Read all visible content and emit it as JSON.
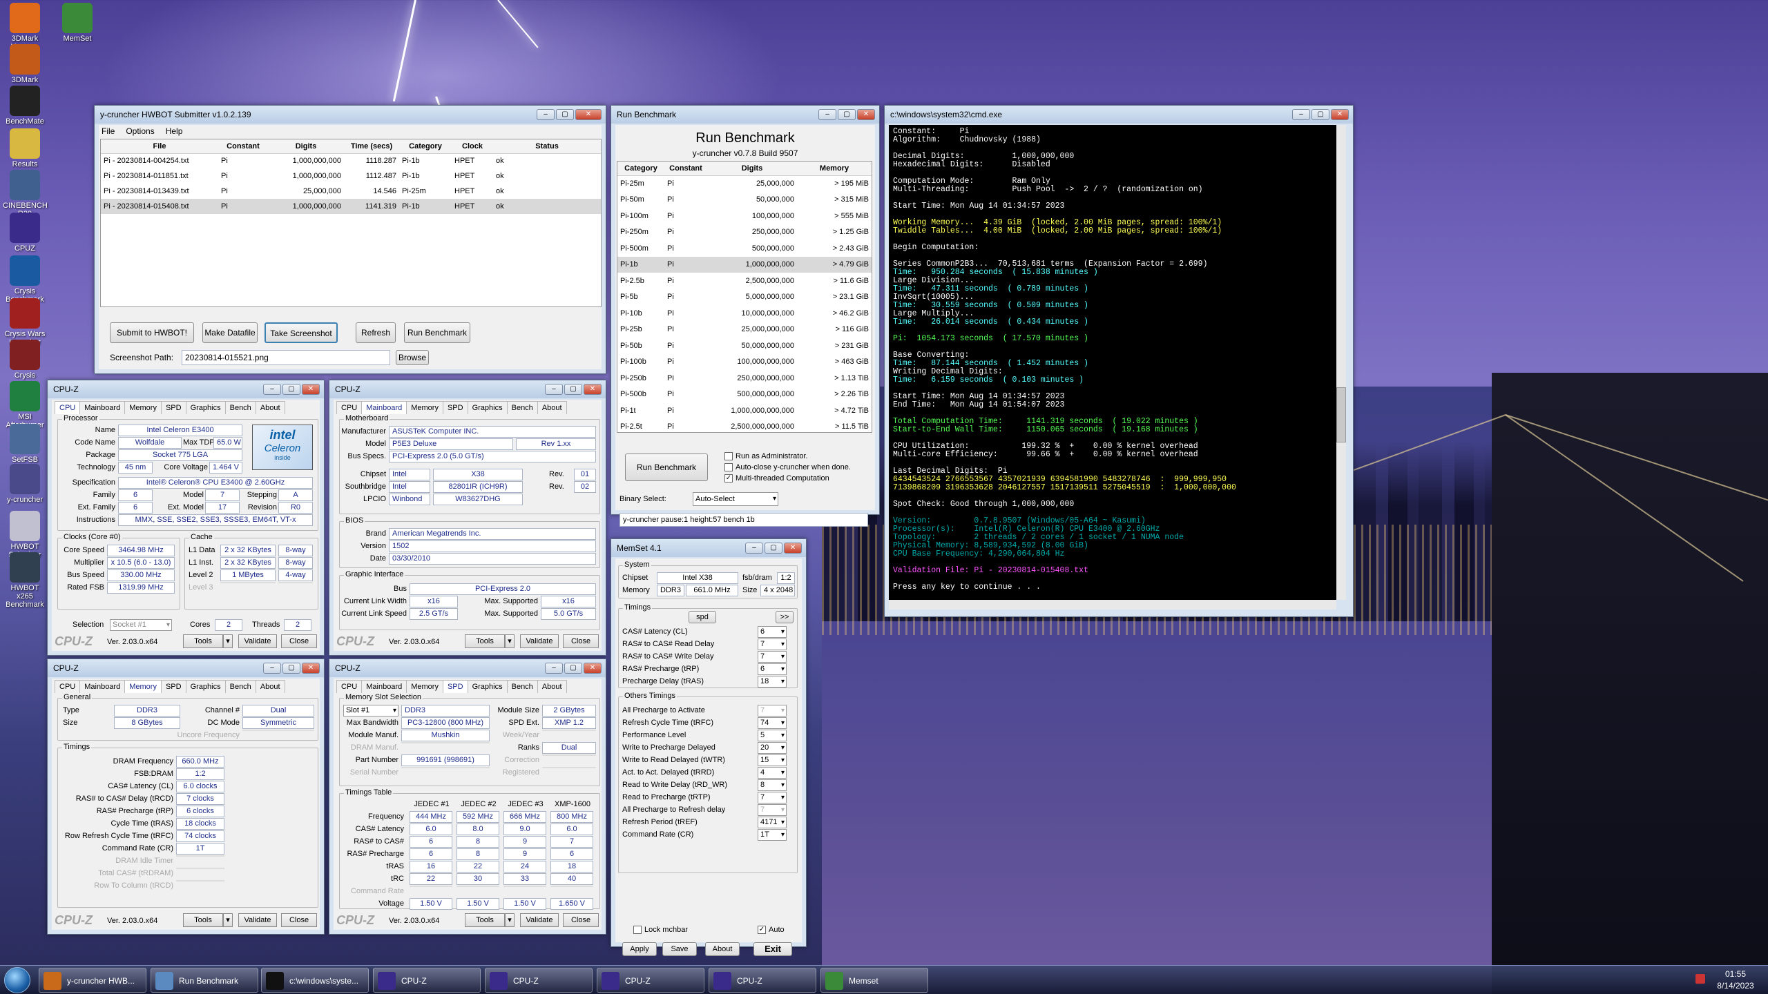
{
  "colors": {
    "accent": "#1e2d8c",
    "console_bg": "#000000"
  },
  "desktop": {
    "icons": [
      {
        "label": "3DMark Vantage",
        "icon": "3dmark-vantage-icon"
      },
      {
        "label": "MemSet",
        "icon": "memset-icon"
      },
      {
        "label": "3DMark",
        "icon": "3dmark-icon"
      },
      {
        "label": "BenchMate",
        "icon": "benchmate-icon"
      },
      {
        "label": "Results",
        "icon": "folder-icon"
      },
      {
        "label": "CINEBENCH R20",
        "icon": "cinebench-icon"
      },
      {
        "label": "CPUZ",
        "icon": "cpuz-icon"
      },
      {
        "label": "Crysis Benchmark",
        "icon": "crysis-icon"
      },
      {
        "label": "Crysis Wars Launcher",
        "icon": "crysis-wars-icon"
      },
      {
        "label": "Crysis",
        "icon": "crysis-icon"
      },
      {
        "label": "MSI Afterburner",
        "icon": "afterburner-icon"
      },
      {
        "label": "SetFSB",
        "icon": "setfsb-icon"
      },
      {
        "label": "y-cruncher",
        "icon": "ycruncher-icon"
      },
      {
        "label": "HWBOT Submitter",
        "icon": "hwbot-icon"
      },
      {
        "label": "HWBOT x265 Benchmark",
        "icon": "hwbot-x265-icon"
      }
    ]
  },
  "submitter": {
    "title": "y-cruncher HWBOT Submitter v1.0.2.139",
    "menu": [
      "File",
      "Options",
      "Help"
    ],
    "columns": [
      "File",
      "Constant",
      "Digits",
      "Time (secs)",
      "Category",
      "Clock",
      "Status"
    ],
    "rows": [
      [
        "Pi - 20230814-004254.txt",
        "Pi",
        "1,000,000,000",
        "1118.287",
        "Pi-1b",
        "HPET",
        "ok"
      ],
      [
        "Pi - 20230814-011851.txt",
        "Pi",
        "1,000,000,000",
        "1112.487",
        "Pi-1b",
        "HPET",
        "ok"
      ],
      [
        "Pi - 20230814-013439.txt",
        "Pi",
        "25,000,000",
        "14.546",
        "Pi-25m",
        "HPET",
        "ok"
      ],
      [
        "Pi - 20230814-015408.txt",
        "Pi",
        "1,000,000,000",
        "1141.319",
        "Pi-1b",
        "HPET",
        "ok"
      ]
    ],
    "buttons": [
      "Submit to HWBOT!",
      "Make Datafile",
      "Take Screenshot",
      "Refresh",
      "Run Benchmark"
    ],
    "screenshot_label": "Screenshot Path:",
    "screenshot_path": "20230814-015521.png",
    "browse": "Browse"
  },
  "runbench": {
    "title": "Run Benchmark",
    "heading": "Run Benchmark",
    "subheading": "y-cruncher v0.7.8 Build 9507",
    "columns": [
      "Category",
      "Constant",
      "Digits",
      "Memory"
    ],
    "rows": [
      [
        "Pi-25m",
        "Pi",
        "25,000,000",
        "> 195 MiB"
      ],
      [
        "Pi-50m",
        "Pi",
        "50,000,000",
        "> 315 MiB"
      ],
      [
        "Pi-100m",
        "Pi",
        "100,000,000",
        "> 555 MiB"
      ],
      [
        "Pi-250m",
        "Pi",
        "250,000,000",
        "> 1.25 GiB"
      ],
      [
        "Pi-500m",
        "Pi",
        "500,000,000",
        "> 2.43 GiB"
      ],
      [
        "Pi-1b",
        "Pi",
        "1,000,000,000",
        "> 4.79 GiB"
      ],
      [
        "Pi-2.5b",
        "Pi",
        "2,500,000,000",
        "> 11.6 GiB"
      ],
      [
        "Pi-5b",
        "Pi",
        "5,000,000,000",
        "> 23.1 GiB"
      ],
      [
        "Pi-10b",
        "Pi",
        "10,000,000,000",
        "> 46.2 GiB"
      ],
      [
        "Pi-25b",
        "Pi",
        "25,000,000,000",
        "> 116 GiB"
      ],
      [
        "Pi-50b",
        "Pi",
        "50,000,000,000",
        "> 231 GiB"
      ],
      [
        "Pi-100b",
        "Pi",
        "100,000,000,000",
        "> 463 GiB"
      ],
      [
        "Pi-250b",
        "Pi",
        "250,000,000,000",
        "> 1.13 TiB"
      ],
      [
        "Pi-500b",
        "Pi",
        "500,000,000,000",
        "> 2.26 TiB"
      ],
      [
        "Pi-1t",
        "Pi",
        "1,000,000,000,000",
        "> 4.72 TiB"
      ],
      [
        "Pi-2.5t",
        "Pi",
        "2,500,000,000,000",
        "> 11.5 TiB"
      ]
    ],
    "run_button": "Run Benchmark",
    "opt_admin": "Run as Administrator.",
    "opt_autoclose": "Auto-close y-cruncher when done.",
    "opt_multi": "Multi-threaded Computation",
    "binary_label": "Binary Select:",
    "binary_value": "Auto-Select",
    "cmdline": "y-cruncher pause:1 height:57 bench 1b"
  },
  "cmd": {
    "title": "c:\\windows\\system32\\cmd.exe",
    "lines": [
      {
        "t": "Constant:     Pi",
        "c": "#ffffff"
      },
      {
        "t": "Algorithm:    Chudnovsky (1988)",
        "c": "#ffffff"
      },
      {
        "t": "",
        "c": "#fff"
      },
      {
        "t": "Decimal Digits:          1,000,000,000",
        "c": "#ffffff"
      },
      {
        "t": "Hexadecimal Digits:      Disabled",
        "c": "#ffffff"
      },
      {
        "t": "",
        "c": "#fff"
      },
      {
        "t": "Computation Mode:        Ram Only",
        "c": "#ffffff"
      },
      {
        "t": "Multi-Threading:         Push Pool  ->  2 / ?  (randomization on)",
        "c": "#ffffff"
      },
      {
        "t": "",
        "c": "#fff"
      },
      {
        "t": "Start Time: Mon Aug 14 01:34:57 2023",
        "c": "#ffffff"
      },
      {
        "t": "",
        "c": "#fff"
      },
      {
        "t": "Working Memory...  4.39 GiB  (locked, 2.00 MiB pages, spread: 100%/1)",
        "c": "#ffff55"
      },
      {
        "t": "Twiddle Tables...  4.00 MiB  (locked, 2.00 MiB pages, spread: 100%/1)",
        "c": "#ffff55"
      },
      {
        "t": "",
        "c": "#fff"
      },
      {
        "t": "Begin Computation:",
        "c": "#ffffff"
      },
      {
        "t": "",
        "c": "#fff"
      },
      {
        "t": "Series CommonP2B3...  70,513,681 terms  (Expansion Factor = 2.699)",
        "c": "#ffffff"
      },
      {
        "t": "Time:   950.284 seconds  ( 15.838 minutes )",
        "c": "#55ffff"
      },
      {
        "t": "Large Division...",
        "c": "#ffffff"
      },
      {
        "t": "Time:   47.311 seconds  ( 0.789 minutes )",
        "c": "#55ffff"
      },
      {
        "t": "InvSqrt(10005)...",
        "c": "#ffffff"
      },
      {
        "t": "Time:   30.559 seconds  ( 0.509 minutes )",
        "c": "#55ffff"
      },
      {
        "t": "Large Multiply...",
        "c": "#ffffff"
      },
      {
        "t": "Time:   26.014 seconds  ( 0.434 minutes )",
        "c": "#55ffff"
      },
      {
        "t": "",
        "c": "#fff"
      },
      {
        "t": "Pi:  1054.173 seconds  ( 17.570 minutes )",
        "c": "#55ff55"
      },
      {
        "t": "",
        "c": "#fff"
      },
      {
        "t": "Base Converting:",
        "c": "#ffffff"
      },
      {
        "t": "Time:   87.144 seconds  ( 1.452 minutes )",
        "c": "#55ffff"
      },
      {
        "t": "Writing Decimal Digits:",
        "c": "#ffffff"
      },
      {
        "t": "Time:   6.159 seconds  ( 0.103 minutes )",
        "c": "#55ffff"
      },
      {
        "t": "",
        "c": "#fff"
      },
      {
        "t": "Start Time: Mon Aug 14 01:34:57 2023",
        "c": "#ffffff"
      },
      {
        "t": "End Time:   Mon Aug 14 01:54:07 2023",
        "c": "#ffffff"
      },
      {
        "t": "",
        "c": "#fff"
      },
      {
        "t": "Total Computation Time:     1141.319 seconds  ( 19.022 minutes )",
        "c": "#55ff55"
      },
      {
        "t": "Start-to-End Wall Time:     1150.065 seconds  ( 19.168 minutes )",
        "c": "#55ff55"
      },
      {
        "t": "",
        "c": "#fff"
      },
      {
        "t": "CPU Utilization:           199.32 %  +    0.00 % kernel overhead",
        "c": "#ffffff"
      },
      {
        "t": "Multi-core Efficiency:      99.66 %  +    0.00 % kernel overhead",
        "c": "#ffffff"
      },
      {
        "t": "",
        "c": "#fff"
      },
      {
        "t": "Last Decimal Digits:  Pi",
        "c": "#ffffff"
      },
      {
        "t": "6434543524 2766553567 4357021939 6394581990 5483278746  :  999,999,950",
        "c": "#ffff55"
      },
      {
        "t": "7139868209 3196353628 2046127557 1517139511 5275045519  :  1,000,000,000",
        "c": "#ffff55"
      },
      {
        "t": "",
        "c": "#fff"
      },
      {
        "t": "Spot Check: Good through 1,000,000,000",
        "c": "#ffffff"
      },
      {
        "t": "",
        "c": "#fff"
      },
      {
        "t": "Version:         0.7.8.9507 (Windows/05-A64 ~ Kasumi)",
        "c": "#00aaaa"
      },
      {
        "t": "Processor(s):    Intel(R) Celeron(R) CPU E3400 @ 2.60GHz",
        "c": "#00aaaa"
      },
      {
        "t": "Topology:        2 threads / 2 cores / 1 socket / 1 NUMA node",
        "c": "#00aaaa"
      },
      {
        "t": "Physical Memory: 8,589,934,592 (8.00 GiB)",
        "c": "#00aaaa"
      },
      {
        "t": "CPU Base Frequency: 4,290,064,804 Hz",
        "c": "#00aaaa"
      },
      {
        "t": "",
        "c": "#fff"
      },
      {
        "t": "Validation File: Pi - 20230814-015408.txt",
        "c": "#ff55ff"
      },
      {
        "t": "",
        "c": "#fff"
      },
      {
        "t": "Press any key to continue . . .",
        "c": "#ffffff"
      }
    ]
  },
  "cpuz_common": {
    "title": "CPU-Z",
    "tabs": [
      "CPU",
      "Mainboard",
      "Memory",
      "SPD",
      "Graphics",
      "Bench",
      "About"
    ],
    "version": "Ver. 2.03.0.x64",
    "tools": "Tools",
    "validate": "Validate",
    "close": "Close",
    "logo": "CPU-Z"
  },
  "cpuz_cpu": {
    "processor_group": "Processor",
    "name_label": "Name",
    "name": "Intel Celeron E3400",
    "codename_label": "Code Name",
    "codename": "Wolfdale",
    "maxtdp_label": "Max TDP",
    "maxtdp": "65.0 W",
    "package_label": "Package",
    "package": "Socket 775 LGA",
    "tech_label": "Technology",
    "tech": "45 nm",
    "cv_label": "Core Voltage",
    "cv": "1.464 V",
    "spec_label": "Specification",
    "spec": "Intel® Celeron® CPU      E3400  @ 2.60GHz",
    "family_label": "Family",
    "family": "6",
    "model_label": "Model",
    "model": "7",
    "stepping_label": "Stepping",
    "stepping": "A",
    "extfamily_label": "Ext. Family",
    "extfamily": "6",
    "extmodel_label": "Ext. Model",
    "extmodel": "17",
    "revision_label": "Revision",
    "revision": "R0",
    "instr_label": "Instructions",
    "instr": "MMX, SSE, SSE2, SSE3, SSSE3, EM64T, VT-x",
    "clocks_group": "Clocks (Core #0)",
    "corespeed_label": "Core Speed",
    "corespeed": "3464.98 MHz",
    "mult_label": "Multiplier",
    "mult": "x 10.5 (6.0 - 13.0)",
    "bus_label": "Bus Speed",
    "bus": "330.00 MHz",
    "fsb_label": "Rated FSB",
    "fsb": "1319.99 MHz",
    "cache_group": "Cache",
    "l1d_label": "L1 Data",
    "l1d": "2 x 32 KBytes",
    "l1d_w": "8-way",
    "l1i_label": "L1 Inst.",
    "l1i": "2 x 32 KBytes",
    "l1i_w": "8-way",
    "l2_label": "Level 2",
    "l2": "1 MBytes",
    "l2_w": "4-way",
    "l3_label": "Level 3",
    "selection_label": "Selection",
    "selection": "Socket #1",
    "cores_label": "Cores",
    "cores": "2",
    "threads_label": "Threads",
    "threads": "2",
    "badge_brand": "intel",
    "badge_product": "Celeron",
    "badge_inside": "inside"
  },
  "cpuz_mb": {
    "mb_group": "Motherboard",
    "manuf_label": "Manufacturer",
    "manuf": "ASUSTeK Computer INC.",
    "model_label": "Model",
    "model": "P5E3 Deluxe",
    "rev": "Rev 1.xx",
    "busspecs_label": "Bus Specs.",
    "busspecs": "PCI-Express 2.0 (5.0 GT/s)",
    "chipset_label": "Chipset",
    "chipset_v": "Intel",
    "chipset_m": "X38",
    "chipset_rev_label": "Rev.",
    "chipset_rev": "01",
    "sb_label": "Southbridge",
    "sb_v": "Intel",
    "sb_m": "82801IR (ICH9R)",
    "sb_rev_label": "Rev.",
    "sb_rev": "02",
    "lpcio_label": "LPCIO",
    "lpcio_v": "Winbond",
    "lpcio_m": "W83627DHG",
    "bios_group": "BIOS",
    "brand_label": "Brand",
    "brand": "American Megatrends Inc.",
    "version_label": "Version",
    "version": "1502",
    "date_label": "Date",
    "date": "03/30/2010",
    "gi_group": "Graphic Interface",
    "gbus_label": "Bus",
    "gbus": "PCI-Express 2.0",
    "clw_label": "Current Link Width",
    "clw": "x16",
    "mls_label": "Max. Supported",
    "mls": "x16",
    "cls_label": "Current Link Speed",
    "cls": "2.5 GT/s",
    "mss_label": "Max. Supported",
    "mss": "5.0 GT/s"
  },
  "cpuz_mem": {
    "general_group": "General",
    "type_label": "Type",
    "type": "DDR3",
    "channel_label": "Channel #",
    "channel": "Dual",
    "size_label": "Size",
    "size": "8 GBytes",
    "dc_label": "DC Mode",
    "dc": "Symmetric",
    "uncore_label": "Uncore Frequency",
    "timings_group": "Timings",
    "rows": [
      {
        "l": "DRAM Frequency",
        "v": "660.0 MHz"
      },
      {
        "l": "FSB:DRAM",
        "v": "1:2"
      },
      {
        "l": "CAS# Latency (CL)",
        "v": "6.0 clocks"
      },
      {
        "l": "RAS# to CAS# Delay (tRCD)",
        "v": "7 clocks"
      },
      {
        "l": "RAS# Precharge (tRP)",
        "v": "6 clocks"
      },
      {
        "l": "Cycle Time (tRAS)",
        "v": "18 clocks"
      },
      {
        "l": "Row Refresh Cycle Time (tRFC)",
        "v": "74 clocks"
      },
      {
        "l": "Command Rate (CR)",
        "v": "1T"
      },
      {
        "l": "DRAM Idle Timer",
        "v": ""
      },
      {
        "l": "Total CAS# (tRDRAM)",
        "v": ""
      },
      {
        "l": "Row To Column (tRCD)",
        "v": ""
      }
    ]
  },
  "cpuz_spd": {
    "slot_group": "Memory Slot Selection",
    "slot": "Slot #1",
    "slot_type": "DDR3",
    "modsize_label": "Module Size",
    "modsize": "2 GBytes",
    "maxbw_label": "Max Bandwidth",
    "maxbw": "PC3-12800 (800 MHz)",
    "spdext_label": "SPD Ext.",
    "spdext": "XMP 1.2",
    "manuf_label": "Module Manuf.",
    "manuf": "Mushkin",
    "week_label": "Week/Year",
    "dram_label": "DRAM Manuf.",
    "ranks_label": "Ranks",
    "ranks": "Dual",
    "part_label": "Part Number",
    "part": "991691 (998691)",
    "corr_label": "Correction",
    "serial_label": "Serial Number",
    "reg_label": "Registered",
    "tt_group": "Timings Table",
    "tt_cols": [
      "JEDEC #1",
      "JEDEC #2",
      "JEDEC #3",
      "XMP-1600"
    ],
    "tt_rows": [
      {
        "l": "Frequency",
        "v": [
          "444 MHz",
          "592 MHz",
          "666 MHz",
          "800 MHz"
        ]
      },
      {
        "l": "CAS# Latency",
        "v": [
          "6.0",
          "8.0",
          "9.0",
          "6.0"
        ]
      },
      {
        "l": "RAS# to CAS#",
        "v": [
          "6",
          "8",
          "9",
          "7"
        ]
      },
      {
        "l": "RAS# Precharge",
        "v": [
          "6",
          "8",
          "9",
          "6"
        ]
      },
      {
        "l": "tRAS",
        "v": [
          "16",
          "22",
          "24",
          "18"
        ]
      },
      {
        "l": "tRC",
        "v": [
          "22",
          "30",
          "33",
          "40"
        ]
      },
      {
        "l": "Command Rate",
        "v": [
          "",
          "",
          "",
          ""
        ]
      },
      {
        "l": "Voltage",
        "v": [
          "1.50 V",
          "1.50 V",
          "1.50 V",
          "1.650 V"
        ]
      }
    ]
  },
  "memset": {
    "title": "MemSet 4.1",
    "system_group": "System",
    "chipset_label": "Chipset",
    "chipset": "Intel  X38",
    "fsbdram_label": "fsb/dram",
    "fsbdram": "1:2",
    "memory_label": "Memory",
    "memtype": "DDR3",
    "memfreq": "661.0 MHz",
    "size_label": "Size",
    "size": "4 x 2048",
    "timings_group": "Timings",
    "spd_btn": "spd",
    "more_btn": ">>",
    "timings": [
      {
        "l": "CAS# Latency (CL)",
        "v": "6"
      },
      {
        "l": "RAS# to CAS# Read Delay",
        "v": "7"
      },
      {
        "l": "RAS# to CAS# Write Delay",
        "v": "7"
      },
      {
        "l": "RAS# Precharge (tRP)",
        "v": "6"
      },
      {
        "l": "Precharge Delay  (tRAS)",
        "v": "18"
      }
    ],
    "other_group": "Others Timings",
    "other": [
      {
        "l": "All Precharge to Activate",
        "v": "7"
      },
      {
        "l": "Refresh Cycle Time (tRFC)",
        "v": "74"
      },
      {
        "l": "Performance Level",
        "v": "5"
      },
      {
        "l": "Write to Precharge Delayed",
        "v": "20"
      },
      {
        "l": "Write to Read Delayed (tWTR)",
        "v": "15"
      },
      {
        "l": "Act. to Act. Delayed (tRRD)",
        "v": "4"
      },
      {
        "l": "Read to Write Delay (tRD_WR)",
        "v": "8"
      },
      {
        "l": "Read to Precharge (tRTP)",
        "v": "7"
      },
      {
        "l": "All Precharge to Refresh delay",
        "v": "7"
      },
      {
        "l": "Refresh Period (tREF)",
        "v": "4171"
      },
      {
        "l": "Command Rate (CR)",
        "v": "1T"
      }
    ],
    "lock": "Lock mchbar",
    "auto": "Auto",
    "apply": "Apply",
    "save": "Save",
    "about": "About",
    "exit": "Exit"
  },
  "taskbar": {
    "items": [
      "y-cruncher HWB...",
      "Run Benchmark",
      "c:\\windows\\syste...",
      "CPU-Z",
      "CPU-Z",
      "CPU-Z",
      "CPU-Z",
      "Memset"
    ],
    "time": "01:55",
    "date": "8/14/2023"
  }
}
